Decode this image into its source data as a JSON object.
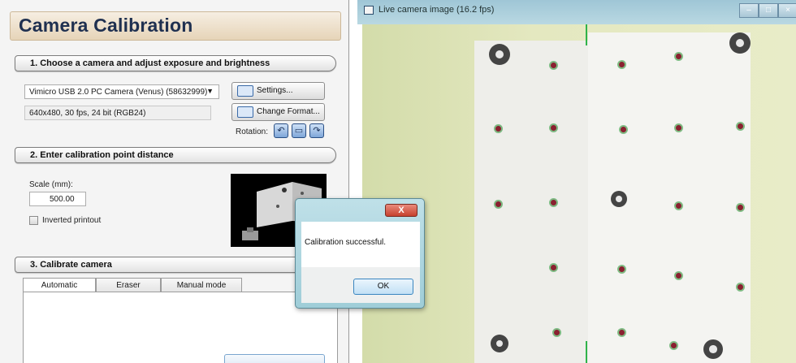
{
  "panel": {
    "title": "Camera Calibration",
    "section1": "1. Choose a camera and adjust exposure and brightness",
    "camera_select": "Vimicro USB 2.0 PC Camera (Venus) (58632999)",
    "format_info": "640x480, 30 fps, 24 bit (RGB24)",
    "settings_button": "Settings...",
    "change_format_button": "Change Format...",
    "rotation_label": "Rotation:",
    "section2": "2. Enter calibration point distance",
    "scale_label": "Scale (mm):",
    "scale_value": "500.00",
    "inverted_label": "Inverted printout",
    "section3": "3. Calibrate camera",
    "tabs": [
      "Automatic",
      "Eraser",
      "Manual mode"
    ]
  },
  "camera_window": {
    "title": "Live camera image (16.2 fps)"
  },
  "message_box": {
    "close": "X",
    "message": "Calibration successful.",
    "ok_button": "OK"
  },
  "colors": {
    "accent": "#1f3050",
    "title_bar": "#9fc6d6",
    "marker_green": "#2fb34a"
  }
}
